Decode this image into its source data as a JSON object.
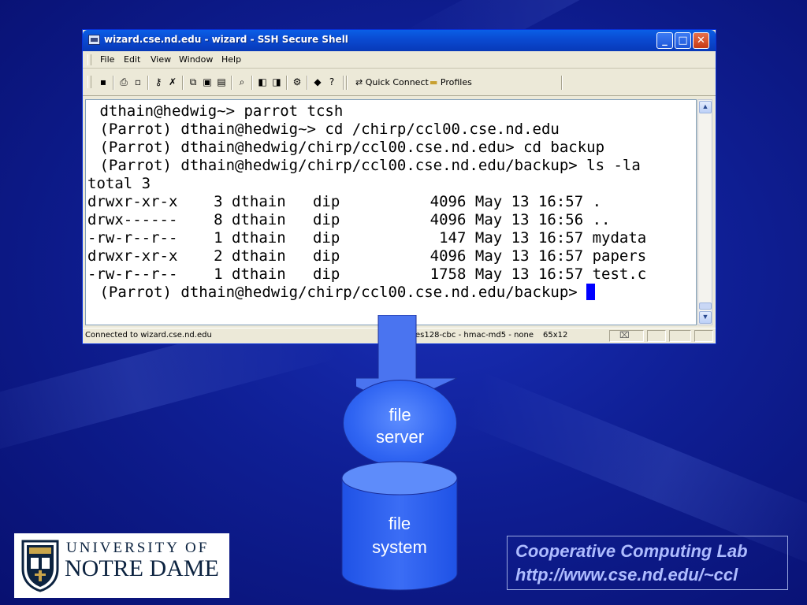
{
  "window": {
    "title": "wizard.cse.nd.edu - wizard - SSH Secure Shell",
    "buttons": {
      "minimize": "_",
      "maximize": "□",
      "close": "✕"
    }
  },
  "menu": [
    "File",
    "Edit",
    "View",
    "Window",
    "Help"
  ],
  "toolbar": {
    "quick_connect": "Quick Connect",
    "profiles": "Profiles"
  },
  "terminal": {
    "lines": [
      " dthain@hedwig~> parrot tcsh",
      " (Parrot) dthain@hedwig~> cd /chirp/ccl00.cse.nd.edu",
      " (Parrot) dthain@hedwig/chirp/ccl00.cse.nd.edu> cd backup",
      " (Parrot) dthain@hedwig/chirp/ccl00.cse.nd.edu/backup> ls -la",
      "total 3",
      "drwxr-xr-x    3 dthain   dip          4096 May 13 16:57 .",
      "drwx------    8 dthain   dip          4096 May 13 16:56 ..",
      "-rw-r--r--    1 dthain   dip           147 May 13 16:57 mydata",
      "drwxr-xr-x    2 dthain   dip          4096 May 13 16:57 papers",
      "-rw-r--r--    1 dthain   dip          1758 May 13 16:57 test.c",
      " (Parrot) dthain@hedwig/chirp/ccl00.cse.nd.edu/backup> "
    ]
  },
  "status": {
    "connection": "Connected to wizard.cse.nd.edu",
    "cipher": "es128-cbc - hmac-md5 - none",
    "size": "65x12"
  },
  "diagram": {
    "server_label": [
      "file",
      "server"
    ],
    "storage_label": [
      "file",
      "system"
    ]
  },
  "logo": {
    "line1": "UNIVERSITY OF",
    "line2": "NOTRE DAME"
  },
  "lab": {
    "name": "Cooperative Computing Lab",
    "url": "http://www.cse.nd.edu/~ccl"
  },
  "colors": {
    "background": "#0f1f95",
    "accent_blue": "#2f64f2",
    "lab_text": "#aebcff",
    "cursor": "#0000ff"
  }
}
